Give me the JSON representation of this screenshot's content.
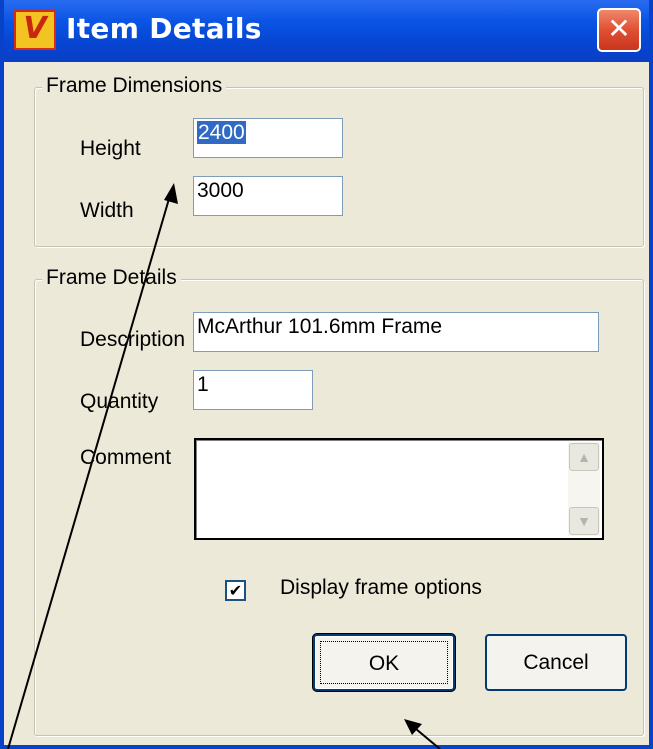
{
  "window": {
    "title": "Item Details",
    "icon_name": "app-v6-icon",
    "close_icon_name": "close-icon",
    "close_glyph": "✕"
  },
  "frame_dimensions": {
    "legend": "Frame Dimensions",
    "height_label": "Height",
    "height_value": "2400",
    "width_label": "Width",
    "width_value": "3000"
  },
  "frame_details": {
    "legend": "Frame Details",
    "description_label": "Description",
    "description_value": "McArthur 101.6mm Frame",
    "quantity_label": "Quantity",
    "quantity_value": "1",
    "comment_label": "Comment",
    "comment_value": "",
    "display_options_label": "Display frame options",
    "display_options_checked": true
  },
  "buttons": {
    "ok_label": "OK",
    "cancel_label": "Cancel"
  },
  "annotations": {
    "color": "#000000",
    "arrow_names": [
      "arrow-to-width-field",
      "arrow-to-ok-button"
    ]
  }
}
